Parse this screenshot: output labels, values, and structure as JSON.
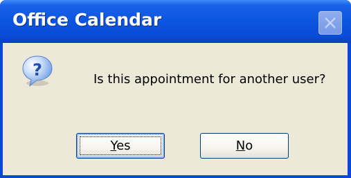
{
  "window": {
    "title": "Office Calendar",
    "close_icon": "close-icon"
  },
  "dialog": {
    "icon": "question-icon",
    "message": "Is this appointment for another user?",
    "buttons": [
      {
        "accel": "Y",
        "rest": "es",
        "default": true
      },
      {
        "accel": "N",
        "rest": "o",
        "default": false
      }
    ]
  },
  "colors": {
    "titlebar": "#0b55e0",
    "dialog_body": "#ece9d8",
    "button_border": "#003c74",
    "icon_blue": "#2d6fd6"
  }
}
